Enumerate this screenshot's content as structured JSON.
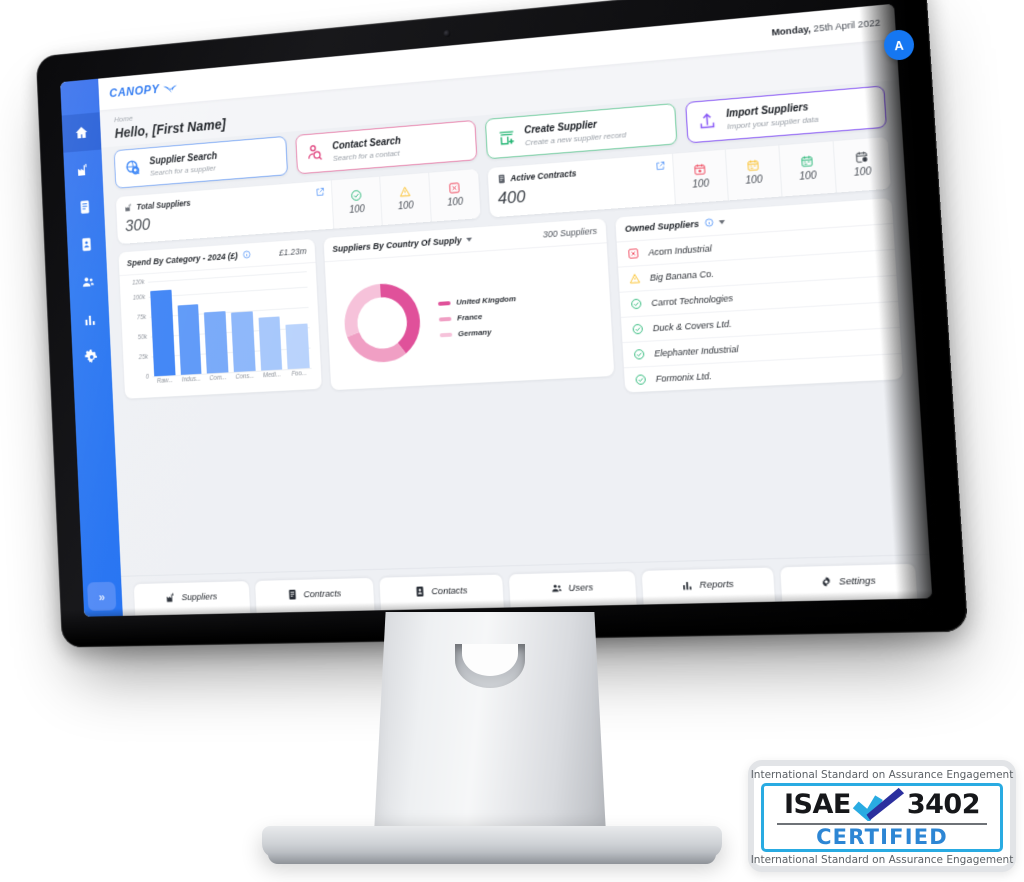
{
  "topbar": {
    "logo_text": "CANOPY",
    "date_day": "Monday,",
    "date_rest": " 25th April 2022",
    "avatar_initial": "A"
  },
  "page": {
    "breadcrumb": "Home",
    "title": "Hello, [First Name]"
  },
  "sidebar": {
    "expand_label": "»",
    "items": [
      {
        "name": "home",
        "label": "Home",
        "active": true
      },
      {
        "name": "suppliers",
        "label": "Suppliers",
        "active": false
      },
      {
        "name": "contracts",
        "label": "Contracts",
        "active": false
      },
      {
        "name": "contacts",
        "label": "Contacts",
        "active": false
      },
      {
        "name": "users",
        "label": "Users",
        "active": false
      },
      {
        "name": "reports",
        "label": "Reports",
        "active": false
      },
      {
        "name": "settings",
        "label": "Settings",
        "active": false
      }
    ]
  },
  "quick_actions": [
    {
      "title": "Supplier Search",
      "subtitle": "Search for a supplier",
      "icon": "supplier-search-icon",
      "color": "#2b7cf6"
    },
    {
      "title": "Contact Search",
      "subtitle": "Search for a contact",
      "icon": "contact-search-icon",
      "color": "#e0457f"
    },
    {
      "title": "Create Supplier",
      "subtitle": "Create a new supplier record",
      "icon": "create-supplier-icon",
      "color": "#22b573"
    },
    {
      "title": "Import Suppliers",
      "subtitle": "Import your supplier data",
      "icon": "import-suppliers-icon",
      "color": "#8b5cf6"
    }
  ],
  "stats": {
    "total_suppliers": {
      "label": "Total Suppliers",
      "value": "300",
      "cells": [
        {
          "icon": "check-circle-icon",
          "color": "#22b573",
          "value": "100"
        },
        {
          "icon": "warning-triangle-icon",
          "color": "#fbbf24",
          "value": "100"
        },
        {
          "icon": "error-square-icon",
          "color": "#ef4056",
          "value": "100"
        }
      ]
    },
    "active_contracts": {
      "label": "Active Contracts",
      "value": "400",
      "cells": [
        {
          "icon": "calendar-red-icon",
          "color": "#ef4056",
          "value": "100"
        },
        {
          "icon": "calendar-amber-icon",
          "color": "#fbbf24",
          "value": "100"
        },
        {
          "icon": "calendar-green-icon",
          "color": "#22b573",
          "value": "100"
        },
        {
          "icon": "calendar-clock-icon",
          "color": "#3a3f47",
          "value": "100"
        }
      ]
    }
  },
  "widgets": {
    "spend": {
      "title": "Spend By Category - 2024 (£)",
      "total": "£1.23m"
    },
    "country": {
      "title": "Suppliers By Country Of Supply",
      "count": "300 Suppliers"
    },
    "owned": {
      "title": "Owned Suppliers",
      "rows": [
        {
          "name": "Acorn Industrial",
          "status": "error-square-icon",
          "color": "#ef4056"
        },
        {
          "name": "Big Banana Co.",
          "status": "warning-triangle-icon",
          "color": "#fbbf24"
        },
        {
          "name": "Carrot Technologies",
          "status": "check-circle-icon",
          "color": "#22b573"
        },
        {
          "name": "Duck & Covers Ltd.",
          "status": "check-circle-icon",
          "color": "#22b573"
        },
        {
          "name": "Elephanter Industrial",
          "status": "check-circle-icon",
          "color": "#22b573"
        },
        {
          "name": "Formonix Ltd.",
          "status": "check-circle-icon",
          "color": "#22b573"
        }
      ]
    }
  },
  "bottom_tabs": [
    {
      "label": "Suppliers",
      "icon": "factory-icon"
    },
    {
      "label": "Contracts",
      "icon": "contract-icon"
    },
    {
      "label": "Contacts",
      "icon": "contact-card-icon"
    },
    {
      "label": "Users",
      "icon": "users-icon"
    },
    {
      "label": "Reports",
      "icon": "bar-chart-icon"
    },
    {
      "label": "Settings",
      "icon": "gear-icon"
    }
  ],
  "isae": {
    "caption_top": "International Standard on Assurance Engagement",
    "caption_bottom": "International Standard on Assurance Engagement",
    "word_left": "ISAE",
    "word_right": "3402",
    "certified": "CERTIFIED"
  },
  "chart_data": [
    {
      "type": "bar",
      "title": "Spend By Category - 2024 (£)",
      "total_label": "£1.23m",
      "categories": [
        "Raw...",
        "Indus...",
        "Com...",
        "Cons...",
        "Medi...",
        "Foo..."
      ],
      "values": [
        108000,
        87000,
        76000,
        74000,
        66000,
        55000
      ],
      "ytick_labels": [
        "0",
        "25k",
        "50k",
        "75k",
        "100k",
        "120k"
      ],
      "yticks": [
        0,
        25000,
        50000,
        75000,
        100000,
        120000
      ],
      "ylim": [
        0,
        120000
      ],
      "xlabel": "",
      "ylabel": "",
      "grid": true,
      "legend": false,
      "colors": [
        "#3b82f6",
        "#5b97f8",
        "#76a8f9",
        "#8cb6fa",
        "#a6c7fb",
        "#b9d3fc"
      ]
    },
    {
      "type": "pie",
      "title": "Suppliers By Country Of Supply",
      "subtitle": "300 Suppliers",
      "donut": true,
      "labels": [
        "United Kingdom",
        "France",
        "Germany"
      ],
      "values": [
        40,
        30,
        30
      ],
      "colors": [
        "#e0519a",
        "#f09fc4",
        "#f6c2da"
      ],
      "legend": "right"
    }
  ]
}
